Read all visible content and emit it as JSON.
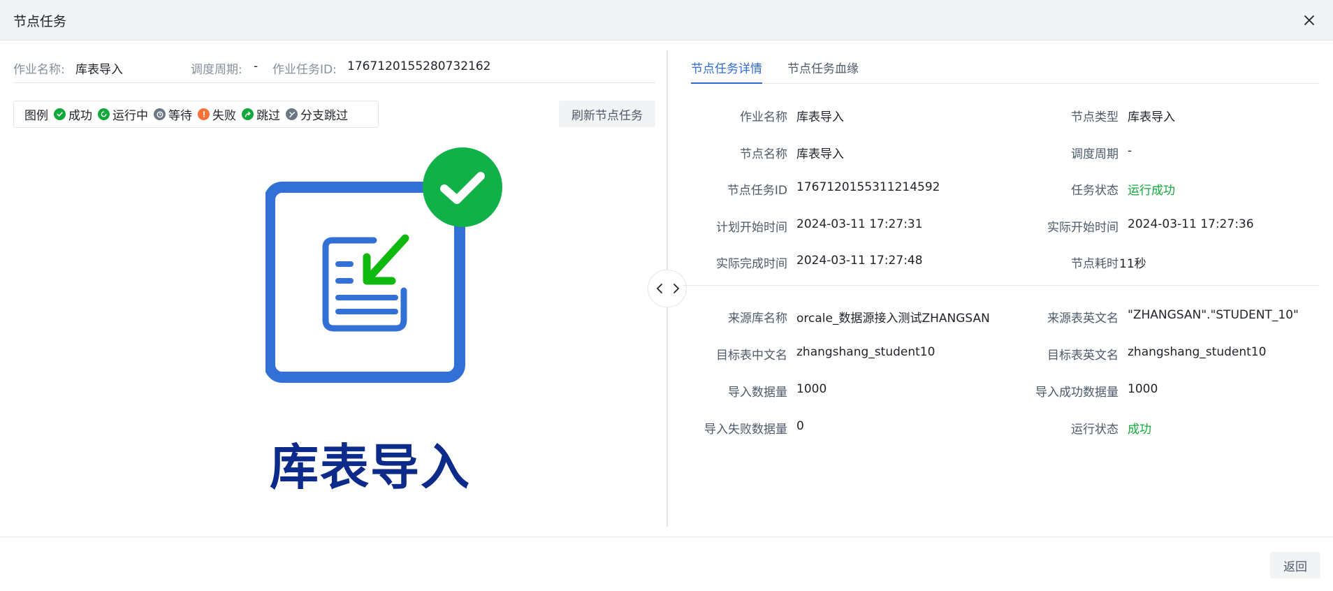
{
  "dialog": {
    "title": "节点任务"
  },
  "job_info": {
    "name_label": "作业名称:",
    "name_value": "库表导入",
    "cycle_label": "调度周期:",
    "cycle_value": "-",
    "task_id_label": "作业任务ID:",
    "task_id_value": "1767120155280732162"
  },
  "legend": {
    "title": "图例",
    "items": [
      {
        "label": "成功",
        "icon": "check-circle-icon",
        "color": "#11a83b"
      },
      {
        "label": "运行中",
        "icon": "running-circle-icon",
        "color": "#11a83b"
      },
      {
        "label": "等待",
        "icon": "clock-circle-icon",
        "color": "#6b7785"
      },
      {
        "label": "失败",
        "icon": "exclamation-circle-icon",
        "color": "#f77234"
      },
      {
        "label": "跳过",
        "icon": "skip-arrow-icon",
        "color": "#11a83b"
      },
      {
        "label": "分支跳过",
        "icon": "branch-skip-icon",
        "color": "#6b7785"
      }
    ]
  },
  "refresh_label": "刷新节点任务",
  "node": {
    "label": "库表导入",
    "icon": "table-import-icon",
    "status_icon": "check-circle-icon",
    "frame_color": "#3370d6",
    "status_color": "#11b14a",
    "label_color": "#0b2a8a"
  },
  "tabs": [
    {
      "label": "节点任务详情",
      "active": true
    },
    {
      "label": "节点任务血缘",
      "active": false
    }
  ],
  "details": {
    "rows": [
      {
        "l1": "作业名称",
        "v1": "库表导入",
        "l2": "节点类型",
        "v2": "库表导入"
      },
      {
        "l1": "节点名称",
        "v1": "库表导入",
        "l2": "调度周期",
        "v2": "-"
      },
      {
        "l1": "节点任务ID",
        "v1": "1767120155311214592",
        "l2": "任务状态",
        "v2": "运行成功"
      },
      {
        "l1": "计划开始时间",
        "v1": "2024-03-11 17:27:31",
        "l2": "实际开始时间",
        "v2": "2024-03-11 17:27:36"
      },
      {
        "l1": "实际完成时间",
        "v1": "2024-03-11 17:27:48",
        "l2": "节点耗时",
        "v2": "11秒"
      }
    ],
    "source_rows": [
      {
        "l1": "来源库名称",
        "v1": "orcale_数据源接入测试ZHANGSAN",
        "l2": "来源表英文名",
        "v2": "\"ZHANGSAN\".\"STUDENT_10\""
      },
      {
        "l1": "目标表中文名",
        "v1": "zhangshang_student10",
        "l2": "目标表英文名",
        "v2": "zhangshang_student10"
      },
      {
        "l1": "导入数据量",
        "v1": "1000",
        "l2": "导入成功数据量",
        "v2": "1000"
      },
      {
        "l1": "导入失败数据量",
        "v1": "0",
        "l2": "运行状态",
        "v2": "成功"
      }
    ],
    "success_color": "#11a83b"
  },
  "footer": {
    "back_label": "返回"
  }
}
